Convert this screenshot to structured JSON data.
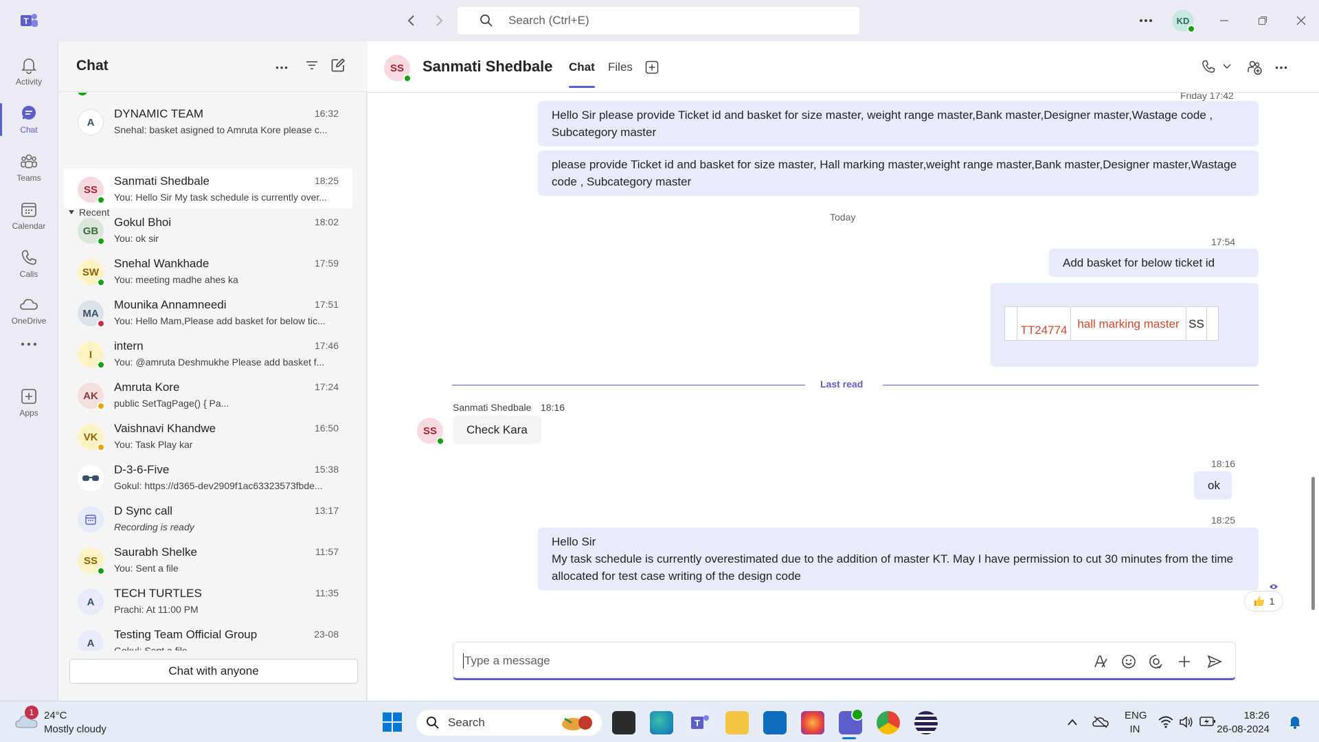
{
  "titlebar": {
    "search_placeholder": "Search (Ctrl+E)",
    "user_initials": "KD"
  },
  "rail": {
    "items": [
      {
        "label": "Activity",
        "icon": "bell-icon"
      },
      {
        "label": "Chat",
        "icon": "chat-icon"
      },
      {
        "label": "Teams",
        "icon": "teams-icon"
      },
      {
        "label": "Calendar",
        "icon": "calendar-icon"
      },
      {
        "label": "Calls",
        "icon": "phone-icon"
      },
      {
        "label": "OneDrive",
        "icon": "cloud-icon"
      },
      {
        "label": "",
        "icon": "more-icon"
      },
      {
        "label": "Apps",
        "icon": "apps-icon"
      }
    ]
  },
  "chatlist": {
    "title": "Chat",
    "recent_label": "Recent",
    "chat_with_anyone": "Chat with anyone",
    "pinned": {
      "initials": "A",
      "name": "DYNAMIC TEAM",
      "time": "16:32",
      "preview": "Snehal: basket asigned to Amruta Kore please c..."
    },
    "items": [
      {
        "initials": "SS",
        "name": "Sanmati Shedbale",
        "time": "18:25",
        "preview": "You: Hello Sir My task schedule is currently over...",
        "presence": "green",
        "color": "#f7dadf",
        "text_color": "#a4262c"
      },
      {
        "initials": "GB",
        "name": "Gokul Bhoi",
        "time": "18:02",
        "preview": "You: ok sir",
        "presence": "green",
        "color": "#dce7dc",
        "text_color": "#3b6e3b"
      },
      {
        "initials": "SW",
        "name": "Snehal Wankhade",
        "time": "17:59",
        "preview": "You: meeting madhe ahes ka",
        "presence": "green",
        "color": "#fdf2c4",
        "text_color": "#8a6500"
      },
      {
        "initials": "MA",
        "name": "Mounika Annamneedi",
        "time": "17:51",
        "preview": "You: Hello Mam,Please add basket for below tic...",
        "presence": "red",
        "color": "#dde3ea",
        "text_color": "#3a4f66"
      },
      {
        "initials": "I",
        "name": "intern",
        "time": "17:46",
        "preview": "You: @amruta Deshmukhe Please add basket f...",
        "presence": "green",
        "color": "#fdf2c4",
        "text_color": "#8a6500"
      },
      {
        "initials": "AK",
        "name": "Amruta Kore",
        "time": "17:24",
        "preview": "public SetTagPage()            {               Pa...",
        "presence": "yellow",
        "color": "#f4dede",
        "text_color": "#8a3b3b"
      },
      {
        "initials": "VK",
        "name": "Vaishnavi Khandwe",
        "time": "16:50",
        "preview": "You: Task Play kar",
        "presence": "yellow",
        "color": "#fdf2c4",
        "text_color": "#8a6500"
      },
      {
        "initials": "",
        "name": "D-3-6-Five",
        "time": "15:38",
        "preview": "Gokul: https://d365-dev2909f1ac63323573fbde...",
        "presence": "",
        "color": "#ffffff",
        "text_color": "#242424"
      },
      {
        "initials": "",
        "name": "D Sync call",
        "time": "13:17",
        "preview": "Recording is ready",
        "presence": "",
        "color": "#e8ebfa",
        "text_color": "#5b5fc7"
      },
      {
        "initials": "SS",
        "name": "Saurabh Shelke",
        "time": "11:57",
        "preview": "You: Sent a file",
        "presence": "green",
        "color": "#fdf2c4",
        "text_color": "#8a6500"
      },
      {
        "initials": "A",
        "name": "TECH TURTLES",
        "time": "11:35",
        "preview": "Prachi: At 11:00 PM",
        "presence": "",
        "color": "#e8ebfa",
        "text_color": "#3a4f66"
      },
      {
        "initials": "A",
        "name": "Testing Team Official Group",
        "time": "23-08",
        "preview": "Gokul: Sent a file",
        "presence": "",
        "color": "#e8ebfa",
        "text_color": "#3a4f66"
      }
    ]
  },
  "conversation": {
    "initials": "SS",
    "name": "Sanmati Shedbale",
    "tabs": [
      "Chat",
      "Files"
    ],
    "top_stamp": "Friday 17:42",
    "msg1": "Hello Sir please provide Ticket id and basket for size master, weight range master,Bank master,Designer master,Wastage code , Subcategory master",
    "msg2": "please provide Ticket id and basket for size master, Hall marking master,weight range master,Bank master,Designer master,Wastage code , Subcategory master",
    "today": "Today",
    "stamp_1754": "17:54",
    "msg3": "Add basket for below ticket id",
    "table": {
      "ticket": "TT24774",
      "item": "hall marking master",
      "initials": "SS"
    },
    "last_read": "Last read",
    "in_sender": "Sanmati Shedbale",
    "in_time": "18:16",
    "in_msg": "Check Kara",
    "stamp_1816": "18:16",
    "msg_ok": "ok",
    "stamp_1825": "18:25",
    "msg_final_1": "Hello Sir",
    "msg_final_2": "My task schedule is currently overestimated due to the addition of master KT. May I have permission to cut 30 minutes from the time allocated for test case writing of the design code",
    "reaction_count": "1",
    "compose_placeholder": "Type a message"
  },
  "taskbar": {
    "weather_temp": "24°C",
    "weather_desc": "Mostly cloudy",
    "weather_badge": "1",
    "search_label": "Search",
    "lang_1": "ENG",
    "lang_2": "IN",
    "time": "18:26",
    "date": "26-08-2024"
  }
}
